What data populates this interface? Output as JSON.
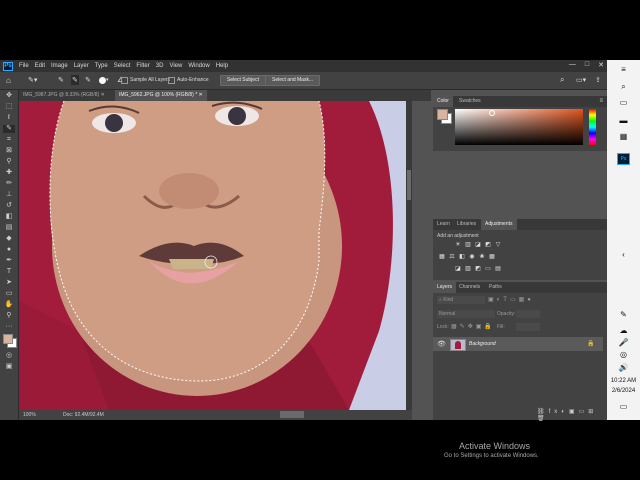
{
  "menu": {
    "items": [
      "File",
      "Edit",
      "Image",
      "Layer",
      "Type",
      "Select",
      "Filter",
      "3D",
      "View",
      "Window",
      "Help"
    ]
  },
  "window_controls": [
    "—",
    "□",
    "✕"
  ],
  "options": {
    "sample_all_layers": "Sample All Layers",
    "auto_enhance": "Auto-Enhance",
    "select_subject": "Select Subject",
    "select_and_mask": "Select and Mask..."
  },
  "tabs": [
    {
      "label": "IMG_5987.JPG @ 8.33% (RGB/8)"
    },
    {
      "label": "IMG_5962.JPG @ 100% (RGB/8) *"
    }
  ],
  "status": {
    "zoom": "100%",
    "doc": "Doc: 92.4M/92.4M"
  },
  "color_panel": {
    "tabs": [
      "Color",
      "Swatches"
    ]
  },
  "adjust_panel": {
    "tabs": [
      "Learn",
      "Libraries",
      "Adjustments"
    ],
    "add_label": "Add an adjustment"
  },
  "layers_panel": {
    "tabs": [
      "Layers",
      "Channels",
      "Paths"
    ],
    "kind": "Kind",
    "blend": "Normal",
    "opacity": "Opacity:",
    "lock": "Lock:",
    "fill": "Fill:",
    "layer_name": "Background"
  },
  "watermark": {
    "title": "Activate Windows",
    "subtitle": "Go to Settings to activate Windows."
  },
  "taskbar": {
    "time": "10:22 AM",
    "date": "2/6/2024"
  },
  "colors": {
    "foreground": "#d8b4a0",
    "background": "#ffffff"
  }
}
